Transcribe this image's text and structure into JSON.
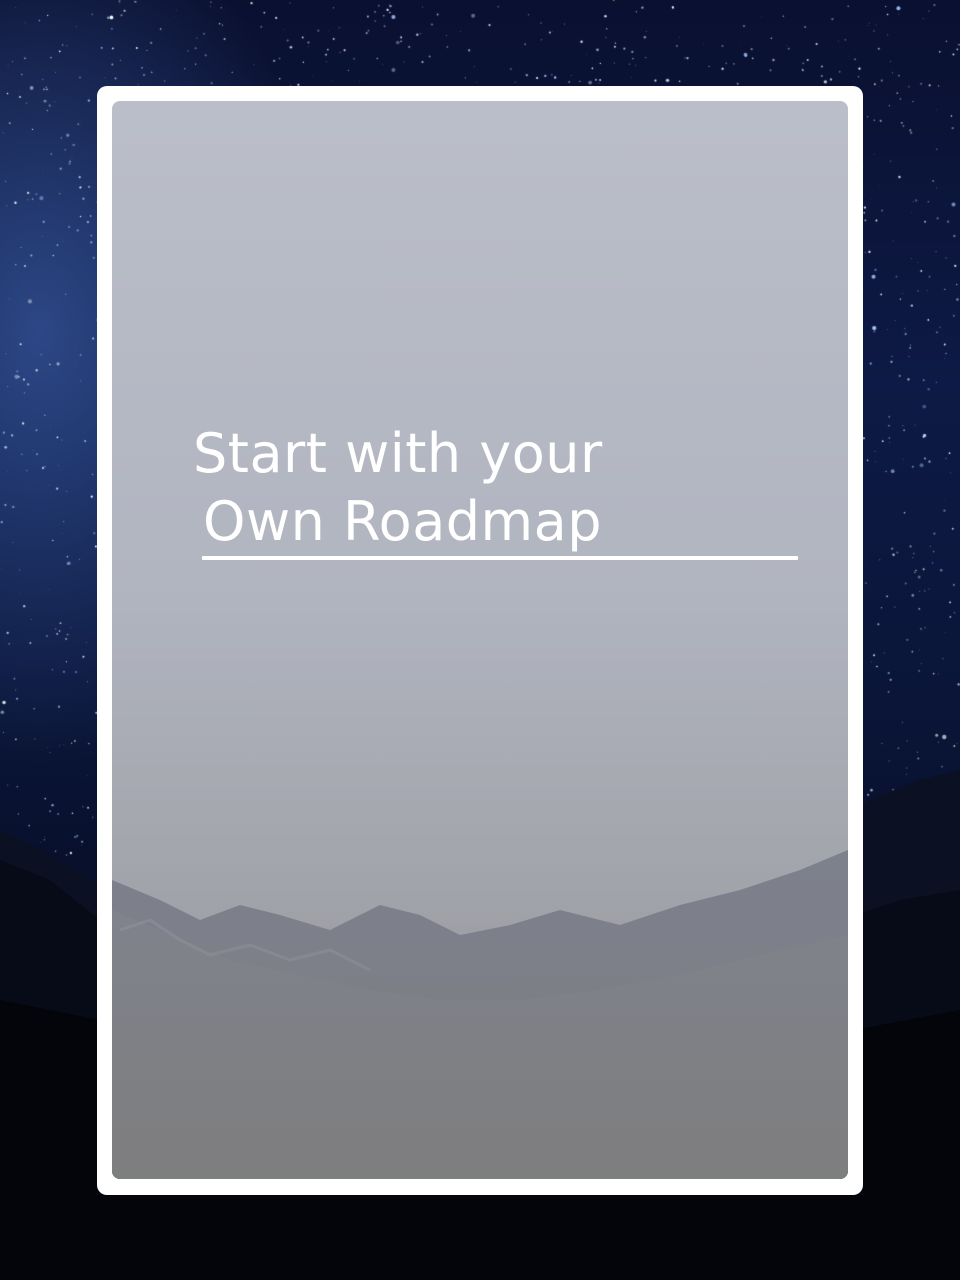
{
  "background": {
    "description_icon": "starry-night-sky",
    "sky_color": "#0d1a45",
    "frame_color": "#ffffff",
    "overlay_color": "#8c8c96"
  },
  "card": {
    "headline_line1": "Start with your",
    "headline_line2": "Own Roadmap"
  }
}
